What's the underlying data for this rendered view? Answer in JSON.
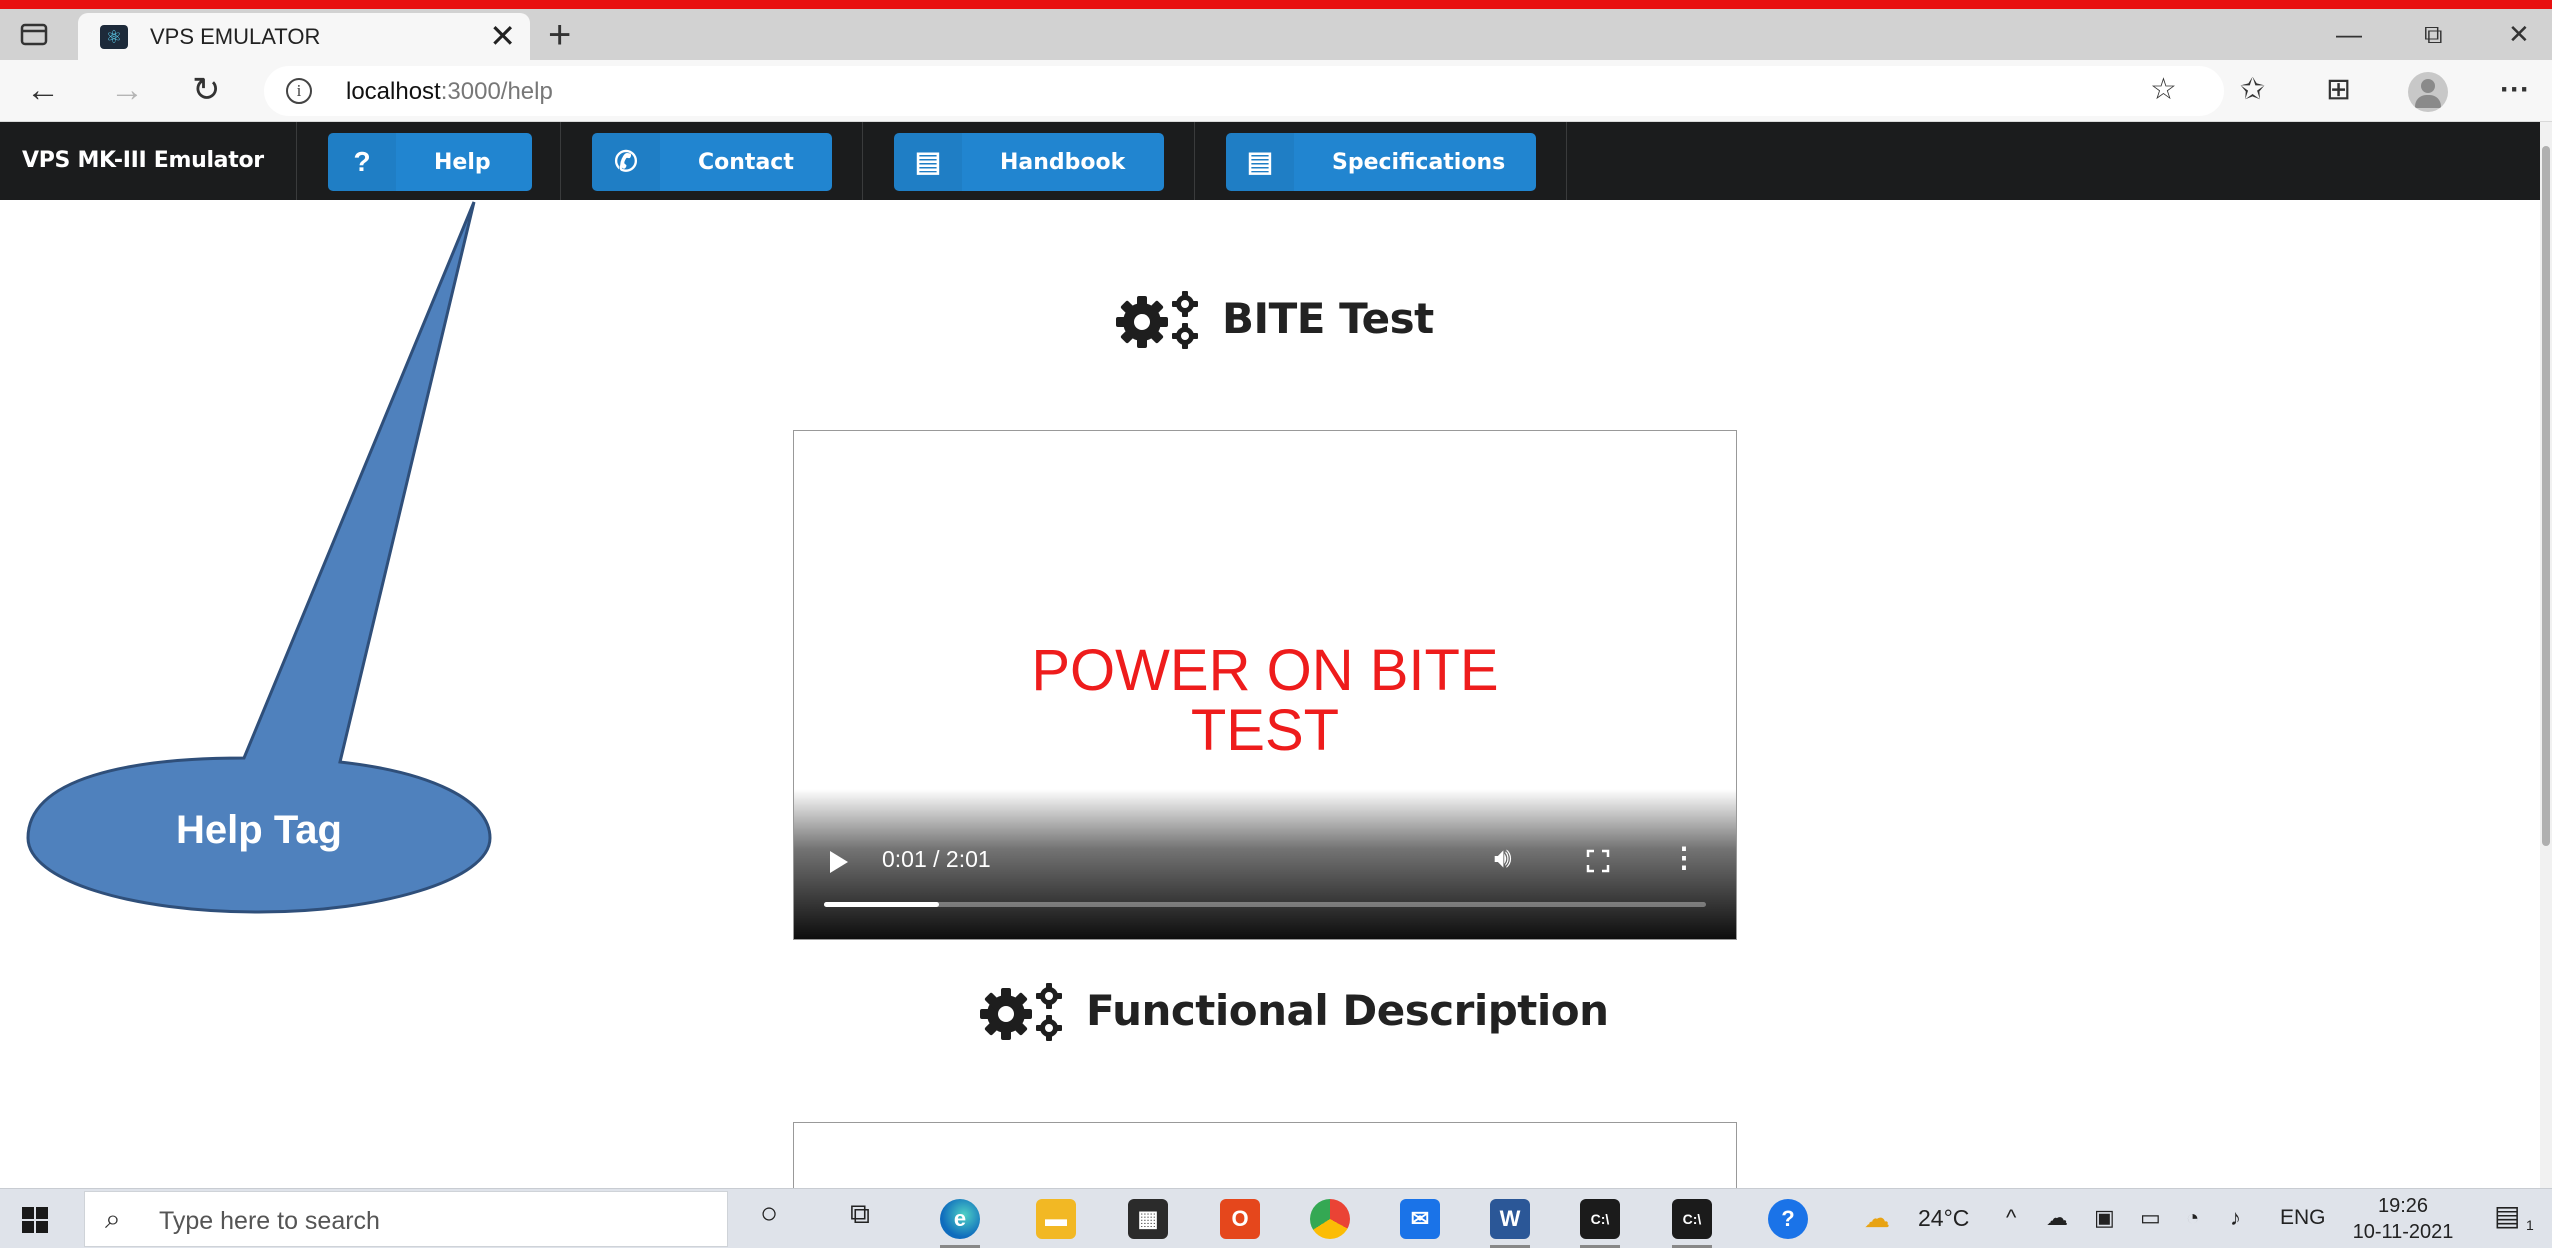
{
  "browser": {
    "tab": {
      "title": "VPS EMULATOR",
      "close": "✕",
      "favicon": "react-logo-icon"
    },
    "new_tab": "+",
    "window_controls": {
      "minimize": "—",
      "restore": "⧉",
      "close": "✕"
    },
    "url_host": "localhost",
    "url_path": ":3000/help",
    "toolbar_icons": [
      "add-favorite-icon",
      "favorites-icon",
      "collections-icon",
      "profile-icon",
      "more-icon"
    ],
    "more": "···"
  },
  "app": {
    "brand": "VPS MK-III Emulator",
    "nav": [
      {
        "label": "Help",
        "icon": "?"
      },
      {
        "label": "Contact",
        "icon": "✆"
      },
      {
        "label": "Handbook",
        "icon": "▤"
      },
      {
        "label": "Specifications",
        "icon": "▤"
      }
    ],
    "accent_color": "#2185d0",
    "navbar_color": "#1b1c1d"
  },
  "content": {
    "sections": [
      {
        "heading": "BITE Test"
      },
      {
        "heading": "Functional Description"
      }
    ],
    "video": {
      "frame_text_line1": "POWER ON BITE",
      "frame_text_line2": "TEST",
      "time": "0:01 / 2:01",
      "progress": 0.13
    }
  },
  "annotation": {
    "label": "Help Tag",
    "fill_color": "#4f81bd"
  },
  "taskbar": {
    "search_placeholder": "Type here to search",
    "weather": "24°C",
    "language": "ENG",
    "time": "19:26",
    "date": "10-11-2021",
    "notification_count": "1"
  }
}
